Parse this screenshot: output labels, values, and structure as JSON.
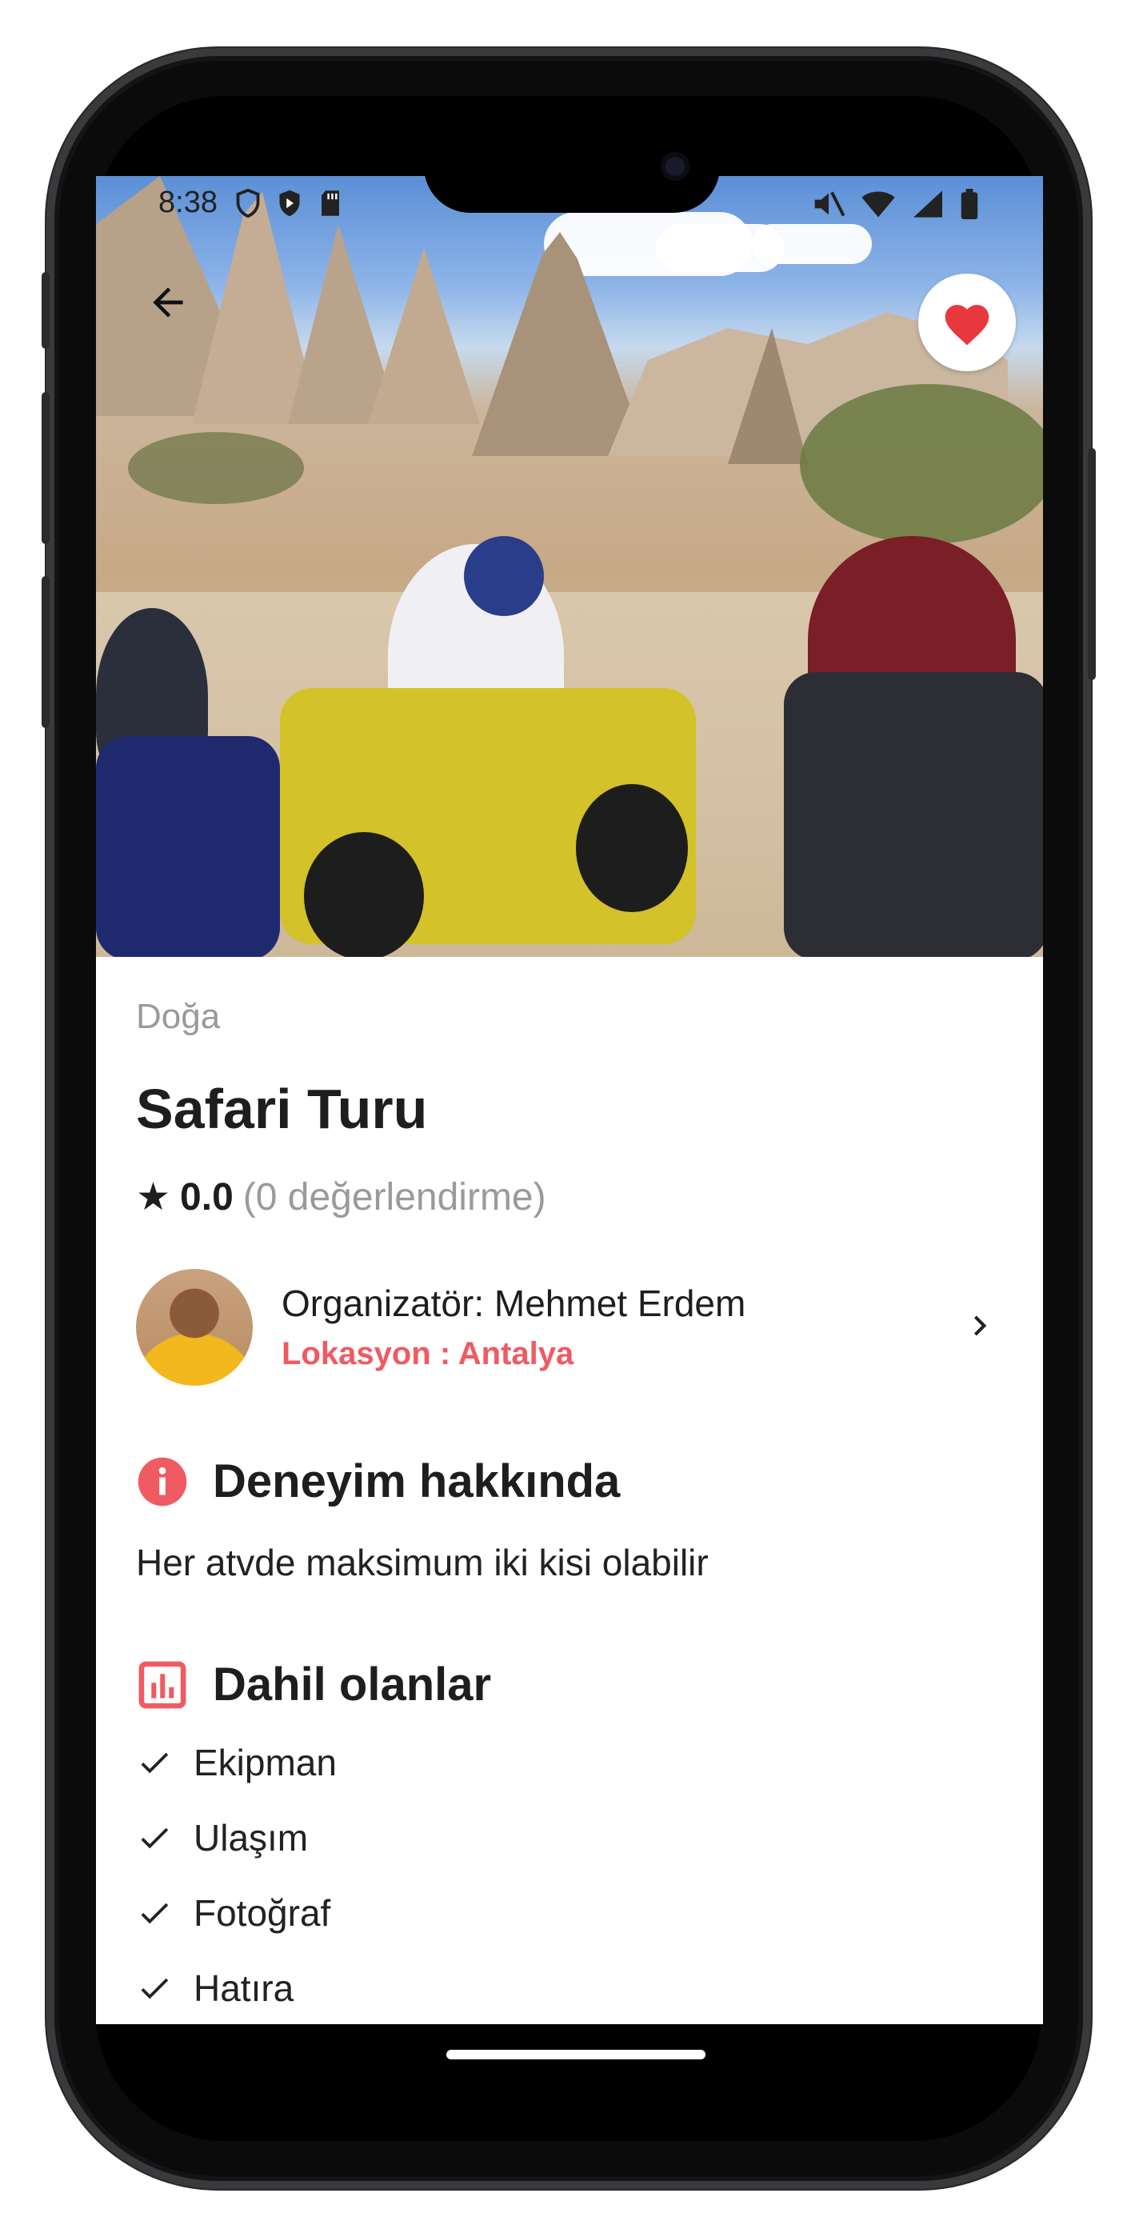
{
  "status_bar": {
    "time": "8:38",
    "left_icons": [
      "shield-icon",
      "shield-check-icon",
      "sd-card-icon"
    ],
    "right_icons": [
      "mute-icon",
      "wifi-icon",
      "signal-icon",
      "battery-icon"
    ]
  },
  "hero": {
    "image_description_icon": "photo",
    "back_icon": "arrow-left-icon",
    "favorite_icon": "heart-icon"
  },
  "experience": {
    "category": "Doğa",
    "title": "Safari Turu",
    "rating_value": "0.0",
    "rating_count": "(0 değerlendirme)"
  },
  "organizer": {
    "name": "Organizatör: Mehmet Erdem",
    "location": "Lokasyon : Antalya"
  },
  "about": {
    "heading": "Deneyim hakkında",
    "text": "Her atvde maksimum iki kisi olabilir"
  },
  "included": {
    "heading": "Dahil olanlar",
    "items": [
      "Ekipman",
      "Ulaşım",
      "Fotoğraf",
      "Hatıra"
    ]
  },
  "colors": {
    "accent": "#f05a62",
    "heart": "#e8383d",
    "text": "#1e1e1e",
    "muted": "#9a9a9a"
  }
}
